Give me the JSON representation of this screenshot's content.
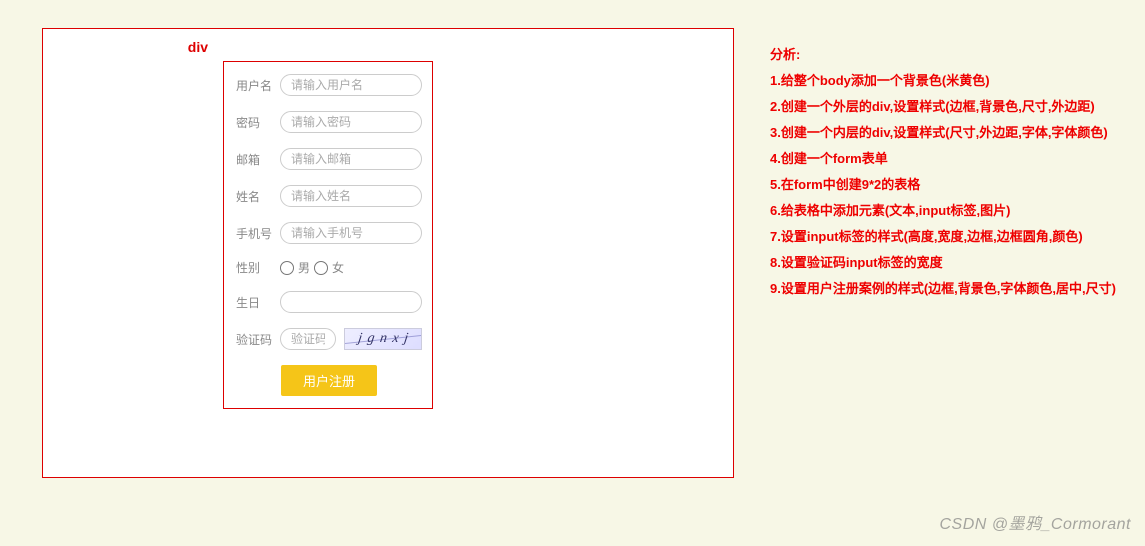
{
  "outer_label": "div",
  "inner_label": "div",
  "form": {
    "username": {
      "label": "用户名",
      "placeholder": "请输入用户名"
    },
    "password": {
      "label": "密码",
      "placeholder": "请输入密码"
    },
    "email": {
      "label": "邮箱",
      "placeholder": "请输入邮箱"
    },
    "name": {
      "label": "姓名",
      "placeholder": "请输入姓名"
    },
    "phone": {
      "label": "手机号",
      "placeholder": "请输入手机号"
    },
    "gender": {
      "label": "性别",
      "male": "男",
      "female": "女"
    },
    "birthday": {
      "label": "生日",
      "placeholder": ""
    },
    "captcha": {
      "label": "验证码",
      "placeholder": "验证码",
      "image_text": "j g n x j"
    },
    "submit": "用户注册"
  },
  "analysis": {
    "title": "分析:",
    "steps": [
      "1.给整个body添加一个背景色(米黄色)",
      "2.创建一个外层的div,设置样式(边框,背景色,尺寸,外边距)",
      "3.创建一个内层的div,设置样式(尺寸,外边距,字体,字体颜色)",
      "4.创建一个form表单",
      "5.在form中创建9*2的表格",
      "6.给表格中添加元素(文本,input标签,图片)",
      "7.设置input标签的样式(高度,宽度,边框,边框圆角,颜色)",
      "8.设置验证码input标签的宽度",
      "9.设置用户注册案例的样式(边框,背景色,字体颜色,居中,尺寸)"
    ]
  },
  "watermark": "CSDN @墨鸦_Cormorant"
}
